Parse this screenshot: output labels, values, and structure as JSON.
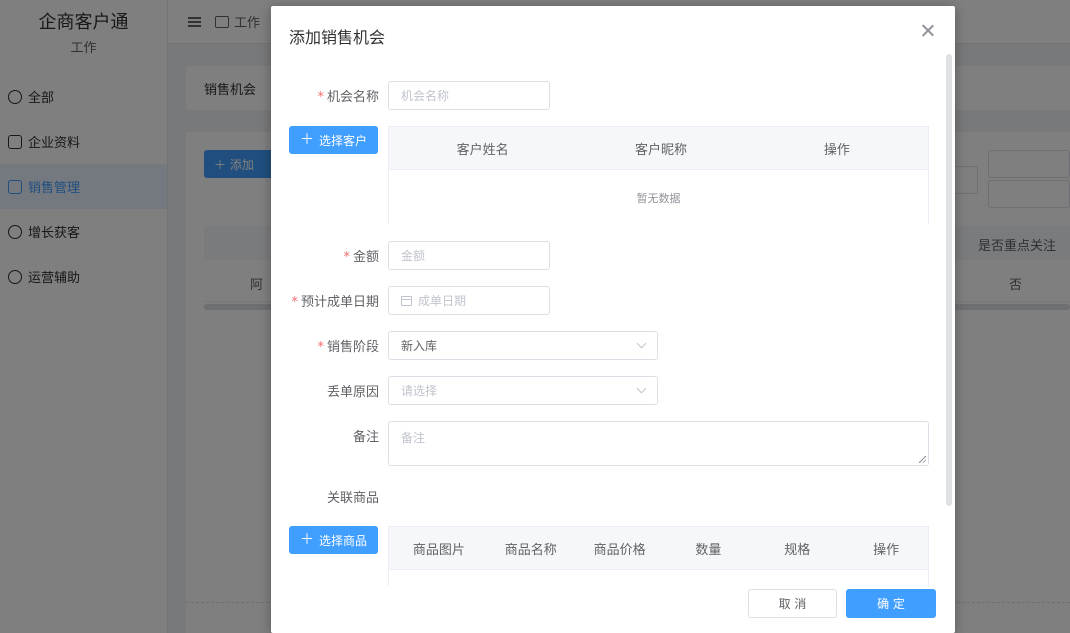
{
  "app": {
    "logo_title": "企商客户通",
    "logo_subtitle": "工作",
    "nav": [
      {
        "label": "全部"
      },
      {
        "label": "企业资料"
      },
      {
        "label": "销售管理"
      },
      {
        "label": "增长获客"
      },
      {
        "label": "运营辅助"
      }
    ],
    "topbar_label": "工作",
    "breadcrumb": "销售机会",
    "add_button": "＋ 添加",
    "table_header_right": "是否重点关注",
    "row_left": "阿",
    "row_right": "否"
  },
  "dialog": {
    "title": "添加销售机会",
    "fields": {
      "name": {
        "label": "机会名称",
        "placeholder": "机会名称"
      },
      "amount": {
        "label": "金额",
        "placeholder": "金额"
      },
      "close_date": {
        "label": "预计成单日期",
        "placeholder": "成单日期"
      },
      "stage": {
        "label": "销售阶段",
        "value": "新入库"
      },
      "lost_reason": {
        "label": "丢单原因",
        "placeholder": "请选择"
      },
      "remark": {
        "label": "备注",
        "placeholder": "备注"
      },
      "products": {
        "label": "关联商品"
      }
    },
    "select_customer_button": "选择客户",
    "customer_table": {
      "columns": [
        "客户姓名",
        "客户昵称",
        "操作"
      ],
      "empty_text": "暂无数据"
    },
    "select_product_button": "选择商品",
    "product_table": {
      "columns": [
        "商品图片",
        "商品名称",
        "商品价格",
        "数量",
        "规格",
        "操作"
      ]
    },
    "cancel_button": "取 消",
    "confirm_button": "确 定"
  }
}
